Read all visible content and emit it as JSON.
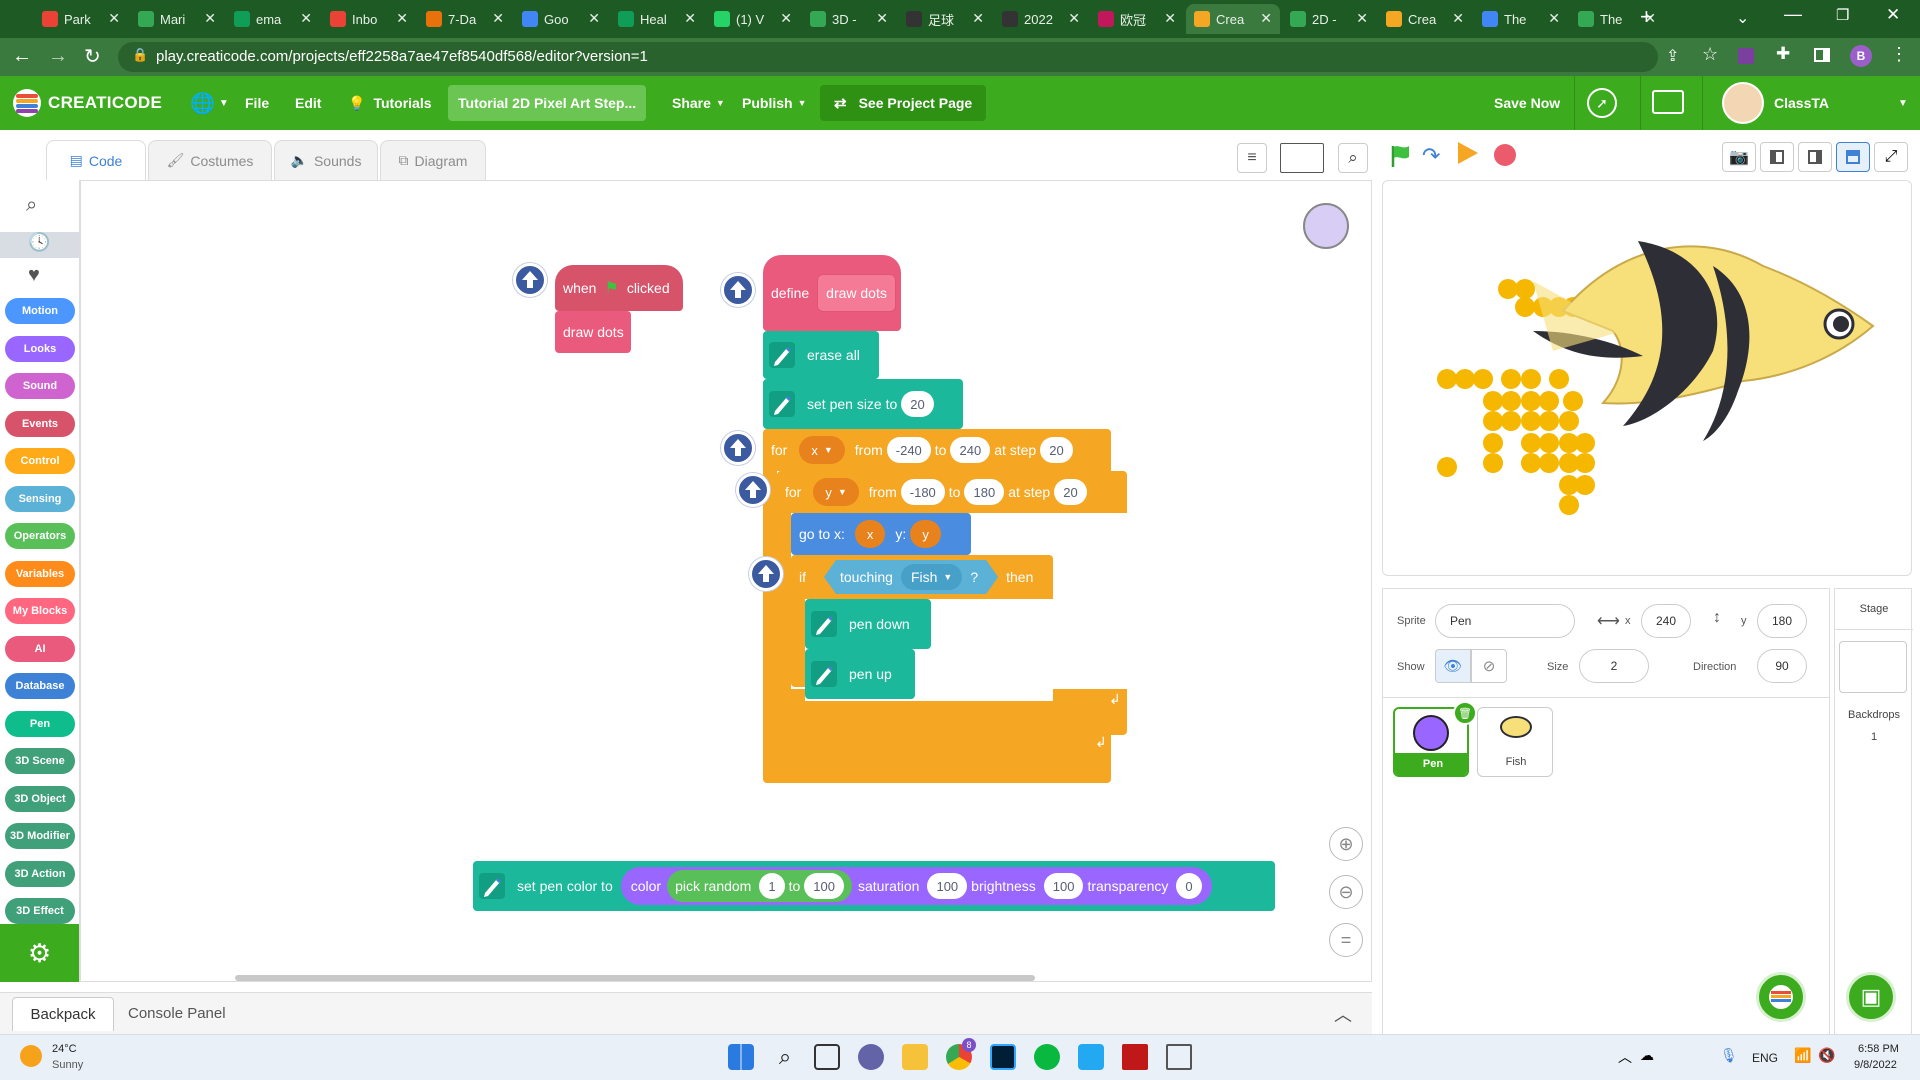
{
  "browser": {
    "tabs": [
      {
        "label": "Park",
        "color": "#ea4335"
      },
      {
        "label": "Mari",
        "color": "#34a853"
      },
      {
        "label": "ema",
        "color": "#0f9d58"
      },
      {
        "label": "Inbo",
        "color": "#ea4335"
      },
      {
        "label": "7-Da",
        "color": "#e8710a"
      },
      {
        "label": "Goo",
        "color": "#4285f4"
      },
      {
        "label": "Heal",
        "color": "#0f9d58"
      },
      {
        "label": "(1) V",
        "color": "#25d366"
      },
      {
        "label": "3D -",
        "color": "#34a853"
      },
      {
        "label": "足球",
        "color": "#333333"
      },
      {
        "label": "2022",
        "color": "#333333"
      },
      {
        "label": "欧冠",
        "color": "#c2185b"
      },
      {
        "label": "Crea",
        "color": "#f5a623"
      },
      {
        "label": "2D -",
        "color": "#34a853"
      },
      {
        "label": "Crea",
        "color": "#f5a623"
      },
      {
        "label": "The",
        "color": "#4285f4"
      },
      {
        "label": "The",
        "color": "#34a853"
      }
    ],
    "url": "play.creaticode.com/projects/eff2258a7ae47ef8540df568/editor?version=1",
    "profile_initial": "B"
  },
  "app": {
    "logo": "CREATICODE",
    "menu": {
      "file": "File",
      "edit": "Edit",
      "tutorials": "Tutorials",
      "share": "Share",
      "publish": "Publish"
    },
    "project_title": "Tutorial 2D Pixel Art Step...",
    "see_project": "See Project Page",
    "save_now": "Save Now",
    "user": "ClassTA"
  },
  "editor_tabs": {
    "code": "Code",
    "costumes": "Costumes",
    "sounds": "Sounds",
    "diagram": "Diagram"
  },
  "categories": [
    {
      "label": "Motion",
      "color": "#4c97ff"
    },
    {
      "label": "Looks",
      "color": "#9966ff"
    },
    {
      "label": "Sound",
      "color": "#cf63cf"
    },
    {
      "label": "Events",
      "color": "#d6536a"
    },
    {
      "label": "Control",
      "color": "#ffab19"
    },
    {
      "label": "Sensing",
      "color": "#5cb1d6"
    },
    {
      "label": "Operators",
      "color": "#59c059"
    },
    {
      "label": "Variables",
      "color": "#ff8c1a"
    },
    {
      "label": "My Blocks",
      "color": "#ff6680"
    },
    {
      "label": "AI",
      "color": "#ea5a7c"
    },
    {
      "label": "Database",
      "color": "#3d82d6"
    },
    {
      "label": "Pen",
      "color": "#0fbd8c"
    },
    {
      "label": "3D Scene",
      "color": "#3fa07a"
    },
    {
      "label": "3D Object",
      "color": "#3fa07a"
    },
    {
      "label": "3D Modifier",
      "color": "#3fa07a"
    },
    {
      "label": "3D Action",
      "color": "#3fa07a"
    },
    {
      "label": "3D Effect",
      "color": "#3fa07a"
    }
  ],
  "blocks": {
    "when": "when",
    "clicked": "clicked",
    "draw_dots_call": "draw dots",
    "define": "define",
    "define_name": "draw dots",
    "erase_all": "erase all",
    "set_pen_size": "set pen size to",
    "pen_size": "20",
    "for": "for",
    "x_var": "x",
    "from": "from",
    "x_from": "-240",
    "to": "to",
    "x_to": "240",
    "at_step": "at step",
    "x_step": "20",
    "y_var": "y",
    "y_from": "-180",
    "y_to": "180",
    "y_step": "20",
    "goto": "go to x:",
    "goto_x": "x",
    "y_label": "y:",
    "goto_y": "y",
    "if": "if",
    "touching": "touching",
    "touching_target": "Fish",
    "q": "?",
    "then": "then",
    "pen_down": "pen down",
    "pen_up": "pen up",
    "set_pen_color": "set pen color to",
    "color": "color",
    "pick_random": "pick random",
    "rand_from": "1",
    "rand_to": "100",
    "saturation": "saturation",
    "sat_val": "100",
    "brightness": "brightness",
    "bri_val": "100",
    "transparency": "transparency",
    "trans_val": "0"
  },
  "sprite_info": {
    "sprite_label": "Sprite",
    "sprite_name": "Pen",
    "x_label": "x",
    "x": "240",
    "y_label": "y",
    "y": "180",
    "show_label": "Show",
    "size_label": "Size",
    "size": "2",
    "direction_label": "Direction",
    "direction": "90"
  },
  "sprites": [
    {
      "name": "Pen"
    },
    {
      "name": "Fish"
    }
  ],
  "stage_panel": {
    "title": "Stage",
    "backdrops_label": "Backdrops",
    "backdrops": "1"
  },
  "bottom": {
    "backpack": "Backpack",
    "console": "Console Panel"
  },
  "taskbar": {
    "temp": "24°C",
    "weather": "Sunny",
    "lang": "ENG",
    "time": "6:58 PM",
    "date": "9/8/2022",
    "chrome_badge": "8"
  }
}
